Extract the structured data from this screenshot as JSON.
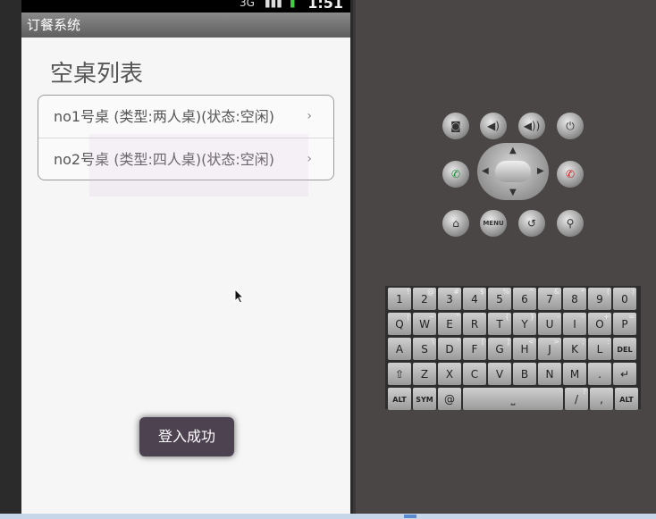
{
  "status_bar": {
    "network": "3G",
    "time": "1:51"
  },
  "app": {
    "title": "订餐系统"
  },
  "screen": {
    "heading": "空桌列表",
    "tables": [
      {
        "label": "no1号桌  (类型:两人桌)(状态:空闲)"
      },
      {
        "label": "no2号桌  (类型:四人桌)(状态:空闲)"
      }
    ],
    "chevron": "›",
    "toast": "登入成功"
  },
  "emulator": {
    "buttons": {
      "menu": "MENU"
    },
    "keyboard": {
      "row1": [
        [
          "1",
          "!"
        ],
        [
          "2",
          "@"
        ],
        [
          "3",
          "#"
        ],
        [
          "4",
          "$"
        ],
        [
          "5",
          "%"
        ],
        [
          "6",
          "^"
        ],
        [
          "7",
          "&"
        ],
        [
          "8",
          "*"
        ],
        [
          "9",
          "("
        ],
        [
          "0",
          ")"
        ]
      ],
      "row2": [
        [
          "Q",
          "|"
        ],
        [
          "W",
          "~"
        ],
        [
          "E",
          "\""
        ],
        [
          "R",
          "`"
        ],
        [
          "T",
          "{"
        ],
        [
          "Y",
          "}"
        ],
        [
          "U",
          "-"
        ],
        [
          "I",
          "-"
        ],
        [
          "O",
          "+"
        ],
        [
          "P",
          "="
        ]
      ],
      "row3": [
        [
          "A",
          ""
        ],
        [
          "S",
          "\\"
        ],
        [
          "D",
          "'"
        ],
        [
          "F",
          "["
        ],
        [
          "G",
          "]"
        ],
        [
          "H",
          "<"
        ],
        [
          "J",
          ">"
        ],
        [
          "K",
          ";"
        ],
        [
          "L",
          ":"
        ],
        [
          "DEL",
          ""
        ]
      ],
      "row4": [
        [
          "⇧",
          ""
        ],
        [
          "Z",
          ""
        ],
        [
          "X",
          ""
        ],
        [
          "C",
          ""
        ],
        [
          "V",
          ""
        ],
        [
          "B",
          ""
        ],
        [
          "N",
          ""
        ],
        [
          "M",
          ""
        ],
        [
          ".",
          ""
        ],
        [
          "↵",
          ""
        ]
      ],
      "row5": [
        [
          "ALT",
          ""
        ],
        [
          "SYM",
          ""
        ],
        [
          "@",
          ""
        ],
        [
          "⎵",
          ""
        ],
        [
          "/",
          "?"
        ],
        [
          ",",
          ""
        ],
        [
          "ALT",
          ""
        ]
      ]
    }
  }
}
